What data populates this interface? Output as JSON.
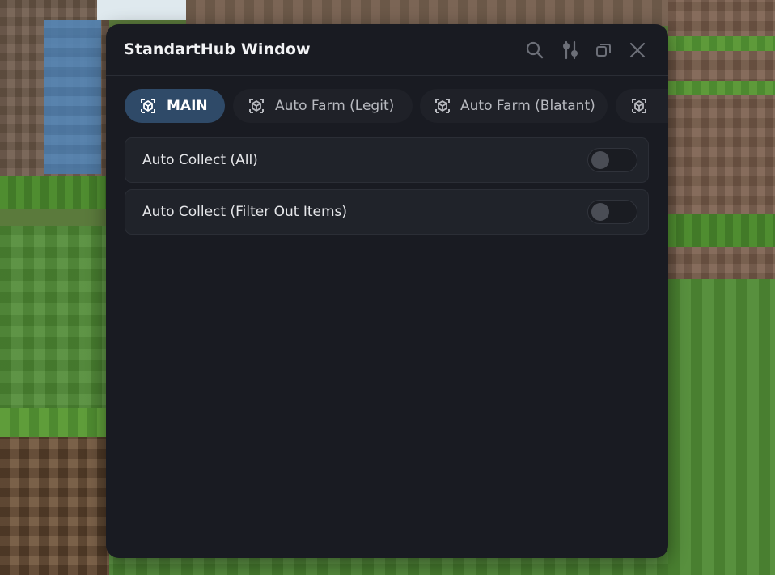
{
  "window": {
    "title": "StandartHub Window",
    "controls": [
      {
        "name": "search",
        "icon": "search-icon"
      },
      {
        "name": "settings",
        "icon": "sliders-icon"
      },
      {
        "name": "restore",
        "icon": "restore-icon"
      },
      {
        "name": "close",
        "icon": "close-icon"
      }
    ]
  },
  "tabs": [
    {
      "label": "MAIN",
      "active": true,
      "icon": "cube-icon"
    },
    {
      "label": "Auto Farm (Legit)",
      "active": false,
      "icon": "cube-icon"
    },
    {
      "label": "Auto Farm (Blatant)",
      "active": false,
      "icon": "cube-icon"
    },
    {
      "label": "",
      "active": false,
      "icon": "cube-icon"
    }
  ],
  "options": [
    {
      "label": "Auto Collect (All)",
      "enabled": false
    },
    {
      "label": "Auto Collect (Filter Out Items)",
      "enabled": false
    }
  ],
  "colors": {
    "window_bg": "#191b22",
    "active_tab": "#2f4a68",
    "text": "#e6e7ea"
  }
}
